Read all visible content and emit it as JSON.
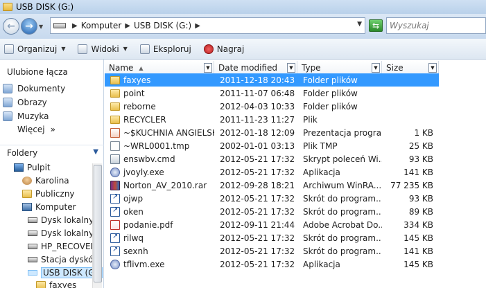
{
  "window": {
    "title": "USB DISK (G:)"
  },
  "address": {
    "crumbs": [
      "Komputer",
      "USB DISK (G:)"
    ],
    "search_placeholder": "Wyszukaj"
  },
  "toolbar": {
    "organize": "Organizuj",
    "views": "Widoki",
    "explore": "Eksploruj",
    "burn": "Nagraj"
  },
  "nav": {
    "favorites_title": "Ulubione łącza",
    "favorites": [
      "Dokumenty",
      "Obrazy",
      "Muzyka"
    ],
    "more": "Więcej",
    "more_glyph": "»",
    "folders_title": "Foldery",
    "tree": [
      {
        "label": "Pulpit",
        "icon": "desktop"
      },
      {
        "label": "Karolina",
        "icon": "user"
      },
      {
        "label": "Publiczny",
        "icon": "folder"
      },
      {
        "label": "Komputer",
        "icon": "computer"
      },
      {
        "label": "Dysk lokalny",
        "icon": "drive"
      },
      {
        "label": "Dysk lokalny",
        "icon": "drive"
      },
      {
        "label": "HP_RECOVER",
        "icon": "drive"
      },
      {
        "label": "Stacja dysków",
        "icon": "drive"
      },
      {
        "label": "USB DISK (G:)",
        "icon": "usb"
      },
      {
        "label": "faxyes",
        "icon": "folder"
      }
    ]
  },
  "columns": {
    "name": "Name",
    "date": "Date modified",
    "type": "Type",
    "size": "Size"
  },
  "files": [
    {
      "name": "faxyes",
      "date": "2011-12-18 20:43",
      "type": "Folder plików",
      "size": "",
      "icon": "folder",
      "selected": true
    },
    {
      "name": "point",
      "date": "2011-11-07 06:48",
      "type": "Folder plików",
      "size": "",
      "icon": "folder"
    },
    {
      "name": "reborne",
      "date": "2012-04-03 10:33",
      "type": "Folder plików",
      "size": "",
      "icon": "folder"
    },
    {
      "name": "RECYCLER",
      "date": "2011-11-23 11:27",
      "type": "Plik",
      "size": "",
      "icon": "folder"
    },
    {
      "name": "~$KUCHNIA ANGIELSK...",
      "date": "2012-01-18 12:09",
      "type": "Prezentacja progra...",
      "size": "1 KB",
      "icon": "ppt"
    },
    {
      "name": "~WRL0001.tmp",
      "date": "2002-01-01 03:13",
      "type": "Plik TMP",
      "size": "25 KB",
      "icon": "tmp"
    },
    {
      "name": "enswbv.cmd",
      "date": "2012-05-21 17:32",
      "type": "Skrypt poleceń Wi...",
      "size": "93 KB",
      "icon": "cmd"
    },
    {
      "name": "jvoyly.exe",
      "date": "2012-05-21 17:32",
      "type": "Aplikacja",
      "size": "141 KB",
      "icon": "exe"
    },
    {
      "name": "Norton_AV_2010.rar",
      "date": "2012-09-28 18:21",
      "type": "Archiwum WinRA...",
      "size": "77 235 KB",
      "icon": "rar"
    },
    {
      "name": "ojwp",
      "date": "2012-05-21 17:32",
      "type": "Skrót do program...",
      "size": "93 KB",
      "icon": "lnk"
    },
    {
      "name": "oken",
      "date": "2012-05-21 17:32",
      "type": "Skrót do program...",
      "size": "89 KB",
      "icon": "lnk"
    },
    {
      "name": "podanie.pdf",
      "date": "2012-09-11 21:44",
      "type": "Adobe Acrobat Do...",
      "size": "334 KB",
      "icon": "pdf"
    },
    {
      "name": "rilwq",
      "date": "2012-05-21 17:32",
      "type": "Skrót do program...",
      "size": "145 KB",
      "icon": "lnk"
    },
    {
      "name": "sexnh",
      "date": "2012-05-21 17:32",
      "type": "Skrót do program...",
      "size": "141 KB",
      "icon": "lnk"
    },
    {
      "name": "tflivm.exe",
      "date": "2012-05-21 17:32",
      "type": "Aplikacja",
      "size": "145 KB",
      "icon": "exe"
    }
  ]
}
